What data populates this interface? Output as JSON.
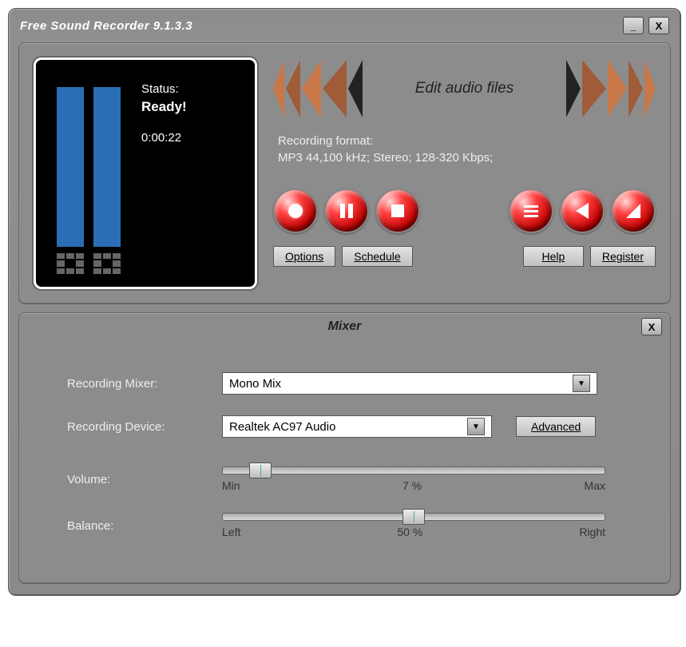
{
  "window": {
    "title": "Free Sound Recorder 9.1.3.3",
    "minimize": "_",
    "close": "X"
  },
  "display": {
    "status_label": "Status:",
    "status_value": "Ready!",
    "time": "0:00:22"
  },
  "banner": {
    "edit_text": "Edit audio files"
  },
  "format": {
    "label": "Recording format:",
    "value": "MP3 44,100 kHz;  Stereo;   128-320 Kbps;"
  },
  "buttons": {
    "options": "Options",
    "schedule": "Schedule",
    "help": "Help",
    "register": "Register"
  },
  "mixer": {
    "title": "Mixer",
    "close": "X",
    "mixer_label": "Recording Mixer:",
    "mixer_value": "Mono Mix",
    "device_label": "Recording Device:",
    "device_value": "Realtek AC97 Audio",
    "advanced": "Advanced",
    "volume_label": "Volume:",
    "volume_min": "Min",
    "volume_pct": "7 %",
    "volume_max": "Max",
    "balance_label": "Balance:",
    "balance_left": "Left",
    "balance_pct": "50 %",
    "balance_right": "Right"
  }
}
